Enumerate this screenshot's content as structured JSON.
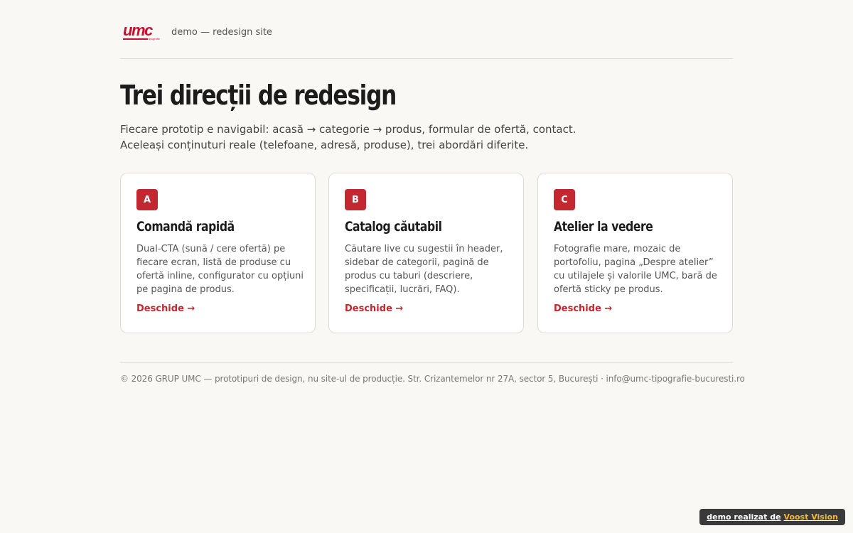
{
  "header": {
    "logo_text": "umc",
    "logo_sub": "tipografie",
    "tagline": "demo — redesign site"
  },
  "hero": {
    "title": "Trei direcții de redesign",
    "intro_line1": "Fiecare prototip e navigabil: acasă → categorie → produs, formular de ofertă, contact.",
    "intro_line2": "Aceleași conținuturi reale (telefoane, adresă, produse), trei abordări diferite."
  },
  "cards": [
    {
      "badge": "A",
      "title": "Comandă rapidă",
      "description": "Dual-CTA (sună / cere ofertă) pe fiecare ecran, listă de produse cu ofertă inline, configurator cu opțiuni pe pagina de produs.",
      "link": "Deschide →"
    },
    {
      "badge": "B",
      "title": "Catalog căutabil",
      "description": "Căutare live cu sugestii în header, sidebar de categorii, pagină de produs cu taburi (descriere, specificații, lucrări, FAQ).",
      "link": "Deschide →"
    },
    {
      "badge": "C",
      "title": "Atelier la vedere",
      "description": "Fotografie mare, mozaic de portofoliu, pagina „Despre atelier” cu utilajele și valorile UMC, bară de ofertă sticky pe produs.",
      "link": "Deschide →"
    }
  ],
  "footer": {
    "text": "© 2026 GRUP UMC — prototipuri de design, nu site-ul de producție. Str. Crizantemelor nr 27A, sector 5, București · info@umc-tipografie-bucuresti.ro"
  },
  "credit": {
    "prefix": "demo realizat de",
    "brand": "Voost Vision"
  },
  "colors": {
    "accent": "#c3272f",
    "background": "#f9f8f5",
    "credit_brand": "#f5b731"
  }
}
